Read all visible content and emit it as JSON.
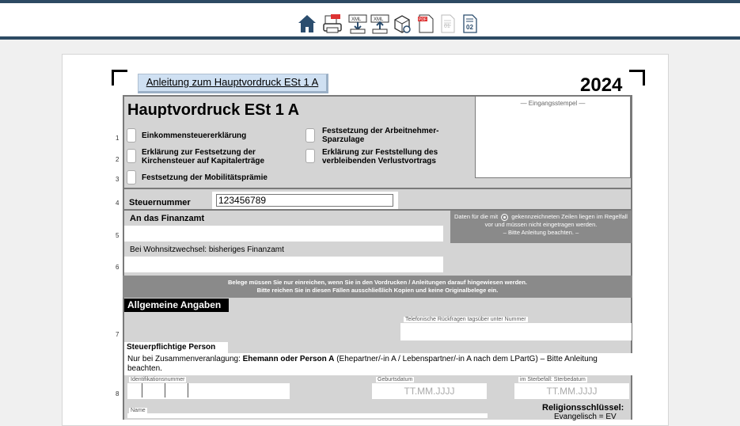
{
  "toolbar": {
    "items": [
      {
        "icon": "home-icon"
      },
      {
        "icon": "print-pdf-icon"
      },
      {
        "icon": "xml-export-icon"
      },
      {
        "icon": "xml-import-icon"
      },
      {
        "icon": "package-icon"
      },
      {
        "icon": "pdf-document-icon"
      },
      {
        "icon": "page-01-icon",
        "label": "01"
      },
      {
        "icon": "page-02-icon",
        "label": "02"
      }
    ]
  },
  "form": {
    "guide_link": "Anleitung zum Hauptvordruck ESt 1 A",
    "year": "2024",
    "title": "Hauptvordruck ESt 1 A",
    "stamp_label": "— Eingangsstempel —",
    "lines": {
      "l1": "1",
      "l2": "2",
      "l3": "3",
      "l4": "4",
      "l5": "5",
      "l6": "6",
      "l7": "7",
      "l8": "8"
    },
    "checkboxes": {
      "est": "Einkommensteuererklärung",
      "kist": "Erklärung zur Festsetzung der Kirchensteuer auf Kapitalerträge",
      "mob": "Festsetzung der Mobilitätsprämie",
      "arbn": "Festsetzung der Arbeitnehmer-Sparzulage",
      "verlust": "Erklärung zur Feststellung des verbleibenden Verlustvortrags"
    },
    "steuernummer_label": "Steuernummer",
    "steuernummer_value": "123456789",
    "finanzamt_label": "An das Finanzamt",
    "note_a": "Daten für die mit",
    "note_b": "gekennzeichneten Zeilen liegen im Regelfall vor und müssen nicht eingetragen werden.",
    "note_c": "– Bitte Anleitung beachten. –",
    "wohnsitz_label": "Bei Wohnsitzwechsel: bisheriges Finanzamt",
    "banner_1": "Belege müssen Sie nur einreichen, wenn Sie in den Vordrucken / Anleitungen darauf hingewiesen werden.",
    "banner_2": "Bitte reichen Sie in diesen Fällen ausschließlich Kopien und keine Originalbelege ein.",
    "section_general": "Allgemeine Angaben",
    "phone_label": "Telefonische Rückfragen tagsüber unter Nummer",
    "person_head": "Steuerpflichtige Person",
    "zus_a": "Nur bei Zusammenveranlagung: ",
    "zus_b": "Ehemann oder Person A",
    "zus_c": " (Ehepartner/-in A / Lebenspartner/-in A nach dem LPartG) – Bitte Anleitung beachten.",
    "idnr_label": "Identifikationsnummer",
    "geburt_label": "Geburtsdatum",
    "geburt_placeholder": "TT.MM.JJJJ",
    "sterbe_label": "im Sterbefall: Sterbedatum",
    "sterbe_placeholder": "TT.MM.JJJJ",
    "name_label": "Name",
    "religion_label": "Religionsschlüssel:",
    "religion_value": "Evangelisch = EV"
  }
}
